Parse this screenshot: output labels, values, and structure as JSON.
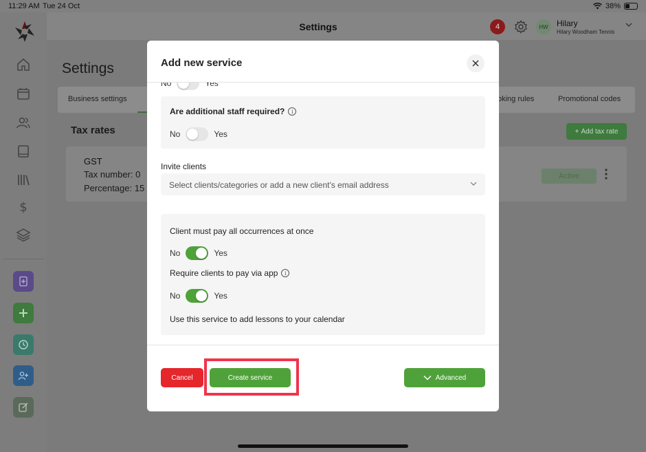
{
  "status_bar": {
    "time": "11:29 AM",
    "date": "Tue 24 Oct",
    "battery": "38%"
  },
  "header": {
    "title": "Settings",
    "notification_count": "4",
    "user": {
      "initials": "HW",
      "name": "Hilary",
      "business": "Hilary Woodham Tennis"
    }
  },
  "page": {
    "title": "Settings",
    "tabs": [
      {
        "label": "Business settings"
      },
      {
        "label": "oking rules"
      },
      {
        "label": "Promotional codes"
      }
    ],
    "tax_section": {
      "title": "Tax rates",
      "add_button": "Add tax rate",
      "card": {
        "name": "GST",
        "tax_number": "Tax number: 0",
        "percentage": "Percentage: 15",
        "status": "Active"
      }
    }
  },
  "modal": {
    "title": "Add new service",
    "top_toggle": {
      "no": "No",
      "yes": "Yes",
      "on": false
    },
    "staff_panel": {
      "label": "Are additional staff required?",
      "no": "No",
      "yes": "Yes",
      "on": false
    },
    "invite": {
      "label": "Invite clients",
      "placeholder": "Select clients/categories or add a new client's email address"
    },
    "payment_panel": {
      "pay_all_label": "Client must pay all occurrences at once",
      "pay_all": {
        "no": "No",
        "yes": "Yes",
        "on": true
      },
      "pay_app_label": "Require clients to pay via app",
      "pay_app": {
        "no": "No",
        "yes": "Yes",
        "on": true
      },
      "calendar_label": "Use this service to add lessons to your calendar"
    },
    "footer": {
      "cancel": "Cancel",
      "create": "Create service",
      "advanced": "Advanced"
    }
  },
  "colors": {
    "primary_green": "#4fa23a",
    "danger_red": "#e5262b",
    "highlight": "#f0344a"
  }
}
